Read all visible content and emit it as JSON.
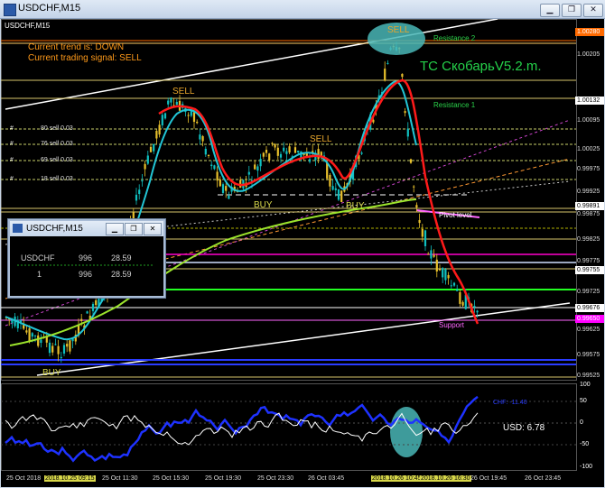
{
  "window": {
    "title": "USDCHF,M15"
  },
  "chart": {
    "symbol_label": "USDCHF,M15",
    "trend_text": "Current trend is: DOWN",
    "signal_text": "Current trading signal: SELL",
    "watermark": "TC СкобарьV5.2.m.",
    "levels": {
      "resistance2": "Resistance 2",
      "resistance1": "Resistance 1",
      "pivot": "Pivot level",
      "support": "Support"
    },
    "signals": [
      {
        "text": "SELL"
      },
      {
        "text": "SELL"
      },
      {
        "text": "SELL"
      },
      {
        "text": "BUY"
      },
      {
        "text": "BUY"
      },
      {
        "text": "BUY"
      }
    ],
    "sell_orders": [
      {
        "text": "80 sell 0.03"
      },
      {
        "text": "76 sell 0.03"
      },
      {
        "text": "69 sell 0.03"
      },
      {
        "text": "18 sell 0.03"
      }
    ],
    "price_labels": [
      {
        "text": "1.00280",
        "color": "#ff6a00"
      },
      {
        "text": "1.00205",
        "color": "#000000"
      },
      {
        "text": "1.00132",
        "color": "#ffffff"
      },
      {
        "text": "1.00095",
        "color": "#000000"
      },
      {
        "text": "1.00025",
        "color": "#000000"
      },
      {
        "text": "0.99975",
        "color": "#000000"
      },
      {
        "text": "0.99925",
        "color": "#000000"
      },
      {
        "text": "0.99891",
        "color": "#ffffff"
      },
      {
        "text": "0.99875",
        "color": "#000000"
      },
      {
        "text": "0.99825",
        "color": "#000000"
      },
      {
        "text": "0.99775",
        "color": "#000000"
      },
      {
        "text": "0.99755",
        "color": "#ffffff"
      },
      {
        "text": "0.99725",
        "color": "#000000"
      },
      {
        "text": "0.99676",
        "color": "#ffffff"
      },
      {
        "text": "0.99650",
        "color": "#ff00ff"
      },
      {
        "text": "0.99625",
        "color": "#000000"
      },
      {
        "text": "0.99575",
        "color": "#000000"
      },
      {
        "text": "0.99525",
        "color": "#000000"
      }
    ],
    "indicator": {
      "usd_text": "USD: 6.78",
      "chf_text": "CHF: -11.40",
      "scale": [
        "100",
        "50",
        "0",
        "-50",
        "-100"
      ]
    },
    "time_labels": [
      "25 Oct 2018",
      "2018.10.25 09:15",
      "25 Oct 11:30",
      "25 Oct 15:30",
      "25 Oct 19:30",
      "25 Oct 23:30",
      "26 Oct 03:45",
      "2018.10.26 10:45",
      "2018.10.26 16:30",
      "26 Oct 19:45",
      "26 Oct 23:45"
    ]
  },
  "mini_window": {
    "title": "USDCHF,M15",
    "rows": [
      {
        "c1": "USDCHF",
        "c2": "996",
        "c3": "28.59"
      },
      {
        "c1": "1",
        "c2": "996",
        "c3": "28.59"
      }
    ]
  },
  "colors": {
    "background": "#000000",
    "fast_ma": "#22c6d6",
    "slow_ma": "#ff1a1a",
    "long_ma": "#9be32c",
    "bull_candle": "#0fc0c0",
    "bear_candle": "#e8c02c",
    "usd_line": "#1e32ff",
    "chf_line": "#ffffff"
  }
}
